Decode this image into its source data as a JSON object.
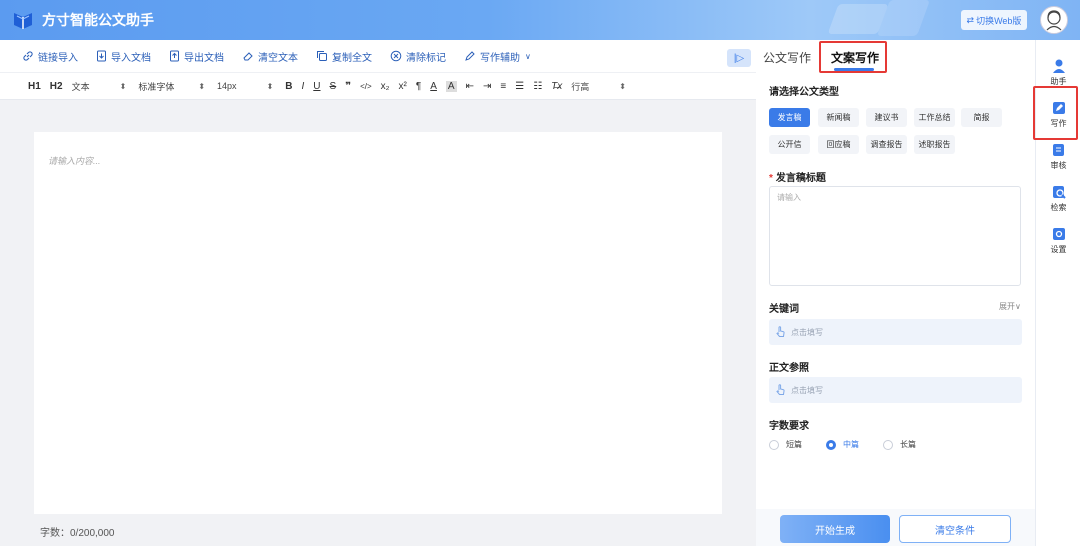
{
  "app": {
    "title": "方寸智能公文助手",
    "switch_label": "切换Web版"
  },
  "toolbar": [
    {
      "label": "链接导入",
      "icon": "link-icon"
    },
    {
      "label": "导入文档",
      "icon": "import-doc-icon"
    },
    {
      "label": "导出文档",
      "icon": "export-doc-icon"
    },
    {
      "label": "清空文本",
      "icon": "eraser-icon"
    },
    {
      "label": "复制全文",
      "icon": "copy-icon"
    },
    {
      "label": "清除标记",
      "icon": "clear-mark-icon"
    },
    {
      "label": "写作辅助",
      "icon": "pen-icon"
    }
  ],
  "format": {
    "h1": "H1",
    "h2": "H2",
    "paragraph": "文本",
    "font": "标准字体",
    "size": "14px",
    "line_height": "行高",
    "bold": "B",
    "italic": "I",
    "underline": "U",
    "strike": "S",
    "quote": "❞",
    "code": "</>",
    "sub": "x₂",
    "sup": "x²",
    "pilcrow": "¶",
    "font_color": "A",
    "bg_color": "A"
  },
  "editor": {
    "placeholder": "请输入内容...",
    "word_count": "字数：0/200,000"
  },
  "panel": {
    "tabs": [
      "公文写作",
      "文案写作"
    ],
    "type_label": "请选择公文类型",
    "types": [
      "发言稿",
      "新闻稿",
      "建议书",
      "工作总结",
      "简报",
      "公开信",
      "回应稿",
      "调查报告",
      "述职报告"
    ],
    "active_type": "发言稿",
    "title_label": "发言稿标题",
    "title_placeholder": "请输入",
    "keywords_label": "关键词",
    "expand_label": "展开∨",
    "keywords_placeholder": "点击填写",
    "reference_label": "正文参照",
    "reference_placeholder": "点击填写",
    "length_label": "字数要求",
    "lengths": [
      "短篇",
      "中篇",
      "长篇"
    ],
    "selected_length": "中篇",
    "generate_button": "开始生成",
    "clear_button": "清空条件"
  },
  "sidebar": [
    {
      "label": "助手",
      "icon": "assistant-icon"
    },
    {
      "label": "写作",
      "icon": "write-icon"
    },
    {
      "label": "审核",
      "icon": "review-icon"
    },
    {
      "label": "检索",
      "icon": "search-icon"
    },
    {
      "label": "设置",
      "icon": "settings-icon"
    }
  ],
  "colors": {
    "primary": "#3a7be8",
    "highlight": "#e53935",
    "header": "#6aa8f3"
  }
}
